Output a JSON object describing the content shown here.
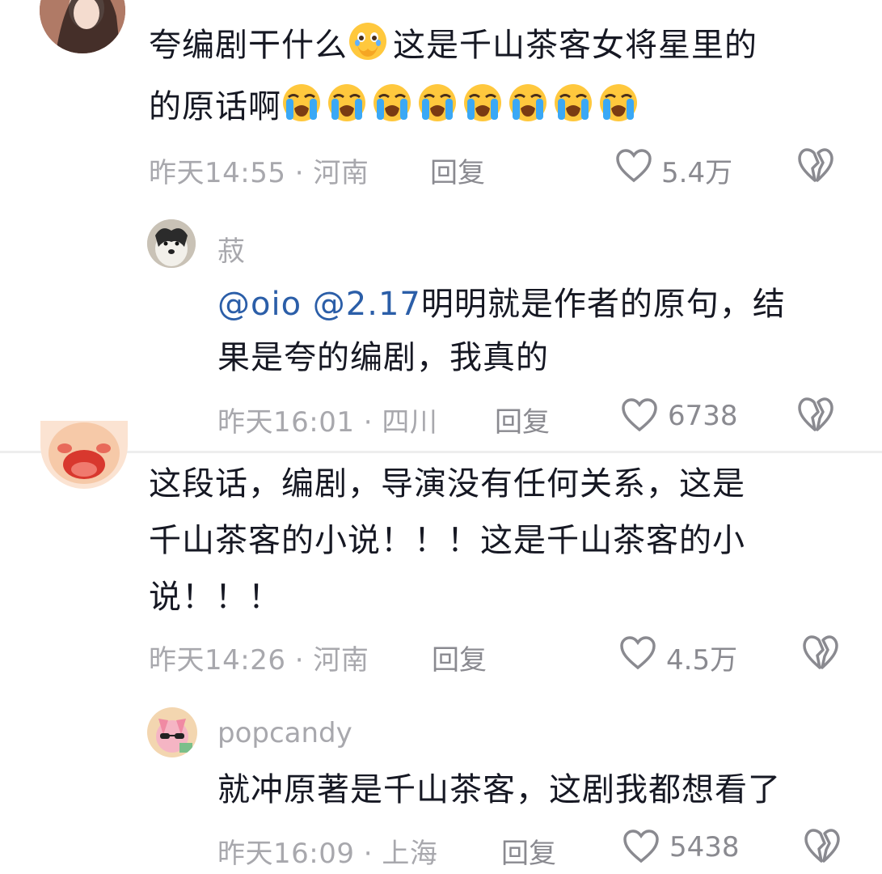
{
  "comments": [
    {
      "lines": [
        "夸编剧干什么",
        "这是千山茶客女将星里的",
        "的原话啊"
      ],
      "meta": "昨天14:55 · 河南",
      "reply_label": "回复",
      "likes": "5.4万",
      "emojis": [
        "face-holding-back-tears-emoji",
        "loudly-crying-face-emoji"
      ],
      "reply": {
        "username": "菽",
        "mentions": [
          "@oio",
          "@2.17"
        ],
        "lines": [
          "明明就是作者的原句，结",
          "果是夸的编剧，我真的"
        ],
        "meta": "昨天16:01 · 四川",
        "reply_label": "回复",
        "likes": "6738"
      }
    },
    {
      "lines": [
        "这段话，编剧，导演没有任何关系，这是",
        "千山茶客的小说！！！这是千山茶客的小",
        "说！！！"
      ],
      "meta": "昨天14:26 · 河南",
      "reply_label": "回复",
      "likes": "4.5万",
      "reply": {
        "username": "popcandy",
        "lines": [
          "就冲原著是千山茶客，这剧我都想看了"
        ],
        "meta": "昨天16:09 · 上海",
        "reply_label": "回复",
        "likes": "5438"
      }
    }
  ],
  "colors": {
    "mention": "#2b5ea8",
    "meta": "#a8a8ad",
    "text": "#161823"
  }
}
